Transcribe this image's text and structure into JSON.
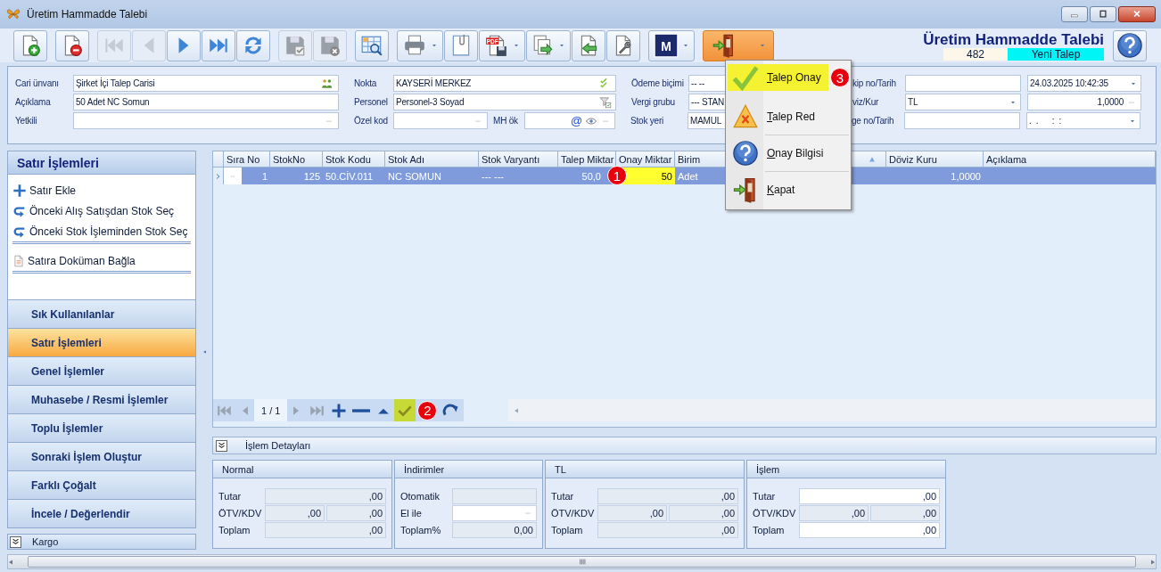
{
  "window": {
    "title": "Üretim Hammadde Talebi"
  },
  "toolbar": [
    [
      {
        "kind": "new",
        "disabled": false
      }
    ],
    [
      {
        "kind": "delete",
        "disabled": false
      }
    ],
    [
      {
        "kind": "first",
        "disabled": true
      },
      {
        "kind": "prev",
        "disabled": true
      },
      {
        "kind": "next",
        "disabled": false
      },
      {
        "kind": "last",
        "disabled": false
      },
      {
        "kind": "refresh",
        "disabled": false
      }
    ],
    [
      {
        "kind": "save",
        "disabled": true
      },
      {
        "kind": "save_close",
        "disabled": true
      }
    ],
    [
      {
        "kind": "grid_search",
        "disabled": false
      }
    ],
    [
      {
        "kind": "print",
        "disabled": false,
        "dropdown": true
      },
      {
        "kind": "attach",
        "disabled": false
      },
      {
        "kind": "pdf",
        "label": "PDF",
        "disabled": false,
        "dropdown": true
      },
      {
        "kind": "export",
        "disabled": false,
        "dropdown": true
      },
      {
        "kind": "import",
        "disabled": false
      },
      {
        "kind": "tools",
        "disabled": false
      }
    ],
    [
      {
        "kind": "logo",
        "label": "M",
        "disabled": false,
        "dropdown": true
      }
    ],
    [
      {
        "kind": "exit",
        "disabled": false,
        "dropdown": true,
        "expanded": true
      }
    ]
  ],
  "header": {
    "title": "Üretim Hammadde Talebi",
    "number": "482",
    "status": "Yeni Talep"
  },
  "form": [
    {
      "cells": [
        {
          "label": "Cari ünvanı",
          "value": "Şirket İçi Talep Carisi",
          "kind": "contact"
        },
        {
          "label": "Nokta",
          "value": "KAYSERİ MERKEZ",
          "kind": "approved"
        },
        {
          "label": "Ödeme biçimi",
          "value": "-- --",
          "kind": "text"
        },
        {
          "label": "kip no/Tarih",
          "kind": "text"
        },
        {
          "value": "24.03.2025 10:42:35",
          "kind": "date"
        }
      ]
    },
    {
      "cells": [
        {
          "label": "Açıklama",
          "value": "50 Adet NC Somun",
          "kind": "text"
        },
        {
          "label": "Personel",
          "value": "Personel-3 Soyad",
          "kind": "filter"
        },
        {
          "label": "Vergi grubu",
          "value": "--- STAN",
          "kind": "text"
        },
        {
          "label": "viz/Kur",
          "value": "TL",
          "kind": "select"
        },
        {
          "value": "1,0000",
          "kind": "rate"
        }
      ]
    },
    {
      "cells": [
        {
          "label": "Yetkili",
          "kind": "browse"
        },
        {
          "label": "Özel kod",
          "kind": "browse"
        },
        {
          "label": "MH ök",
          "at": "@",
          "kind": "code"
        },
        {
          "label": "Stok yeri",
          "value": "MAMUL",
          "kind": "text"
        },
        {
          "label": "ge no/Tarih",
          "kind": "text"
        },
        {
          "value": ".  .      :  :",
          "kind": "date"
        }
      ]
    }
  ],
  "left_panel": {
    "title": "Satır İşlemleri",
    "action_groups": [
      [
        {
          "kind": "add",
          "label": "Satır Ekle"
        },
        {
          "kind": "pick",
          "label": "Önceki Alış Satışdan Stok Seç"
        },
        {
          "kind": "pick",
          "label": "Önceki Stok İşleminden Stok Seç"
        }
      ],
      [
        {
          "kind": "attach",
          "label": "Satıra Doküman Bağla"
        }
      ]
    ],
    "sections": [
      {
        "label": "Sık Kullanılanlar",
        "selected": false
      },
      {
        "label": "Satır İşlemleri",
        "selected": true
      },
      {
        "label": "Genel İşlemler",
        "selected": false
      },
      {
        "label": "Muhasebe / Resmi İşlemler",
        "selected": false
      },
      {
        "label": "Toplu İşlemler",
        "selected": false
      },
      {
        "label": "Sonraki İşlem Oluştur",
        "selected": false
      },
      {
        "label": "Farklı Çoğalt",
        "selected": false
      },
      {
        "label": "İncele / Değerlendir",
        "selected": false
      }
    ],
    "footer": {
      "label": "Kargo",
      "expanded": false
    }
  },
  "table": {
    "columns": [
      {
        "label": "Sıra No"
      },
      {
        "label": "StokNo"
      },
      {
        "label": "Stok Kodu"
      },
      {
        "label": "Stok Adı"
      },
      {
        "label": "Stok Varyantı"
      },
      {
        "label": "Talep Miktar"
      },
      {
        "label": "Onay Miktar"
      },
      {
        "label": "Birim"
      },
      {
        "sorted": true
      },
      {
        "label": "Döviz Kuru"
      },
      {
        "label": "Açıklama"
      }
    ],
    "rows": [
      {
        "selected": true,
        "cells": [
          {
            "text": "1",
            "kind": "number"
          },
          {
            "text": "125",
            "kind": "number"
          },
          {
            "text": "50.CİV.011"
          },
          {
            "text": "NC SOMUN"
          },
          {
            "text": "--- ---"
          },
          {
            "text": "50,0",
            "kind": "number",
            "callout": "1"
          },
          {
            "text": "50",
            "kind": "number",
            "highlight": true
          },
          {
            "text": "Adet"
          },
          {},
          {
            "text": "1,0000",
            "kind": "number"
          },
          {}
        ]
      }
    ],
    "navigator": [
      {
        "kind": "first",
        "disabled": true
      },
      {
        "kind": "prev",
        "disabled": true
      },
      {
        "kind": "page",
        "label": "1 / 1"
      },
      {
        "kind": "next",
        "disabled": true
      },
      {
        "kind": "last",
        "disabled": true
      },
      {
        "kind": "add",
        "disabled": false
      },
      {
        "kind": "remove",
        "disabled": false
      },
      {
        "kind": "up",
        "disabled": false
      },
      {
        "kind": "approve",
        "disabled": false,
        "highlight": true,
        "callout": "2"
      },
      {
        "kind": "redo",
        "disabled": false
      }
    ]
  },
  "details": {
    "title": "İşlem Detayları",
    "expanded": false,
    "groups": [
      {
        "title": "Normal",
        "rows": [
          {
            "label": "Tutar",
            "fields": [
              {
                "value": ",00",
                "editable": false
              }
            ]
          },
          {
            "label": "ÖTV/KDV",
            "fields": [
              {
                "value": ",00",
                "editable": false
              },
              {
                "value": ",00",
                "editable": false
              }
            ]
          },
          {
            "label": "Toplam",
            "fields": [
              {
                "value": ",00",
                "editable": false
              }
            ]
          }
        ]
      },
      {
        "title": "İndirimler",
        "rows": [
          {
            "label": "Otomatik",
            "fields": [
              {
                "editable": false
              }
            ]
          },
          {
            "label": "El ile",
            "fields": [
              {
                "editable": true,
                "kind": "picker"
              }
            ]
          },
          {
            "label": "Toplam%",
            "fields": [
              {
                "value": "0,00",
                "editable": false
              }
            ]
          }
        ]
      },
      {
        "title": "TL",
        "rows": [
          {
            "label": "Tutar",
            "fields": [
              {
                "value": ",00",
                "editable": false
              }
            ]
          },
          {
            "label": "ÖTV/KDV",
            "fields": [
              {
                "value": ",00",
                "editable": false
              },
              {
                "value": ",00",
                "editable": false
              }
            ]
          },
          {
            "label": "Toplam",
            "fields": [
              {
                "value": ",00",
                "editable": false
              }
            ]
          }
        ]
      },
      {
        "title": "İşlem",
        "rows": [
          {
            "label": "Tutar",
            "fields": [
              {
                "value": ",00",
                "editable": true
              }
            ]
          },
          {
            "label": "ÖTV/KDV",
            "fields": [
              {
                "value": ",00",
                "editable": false
              },
              {
                "value": ",00",
                "editable": false
              }
            ]
          },
          {
            "label": "Toplam",
            "fields": [
              {
                "value": ",00",
                "editable": true
              }
            ]
          }
        ]
      }
    ]
  },
  "menu": {
    "groups": [
      [
        {
          "kind": "approve",
          "label": "Talep Onay",
          "selected": true,
          "callout": "3"
        },
        {
          "kind": "reject",
          "label": "Talep Red",
          "selected": false
        }
      ],
      [
        {
          "kind": "info",
          "label": "Onay Bilgisi",
          "selected": false
        }
      ],
      [
        {
          "kind": "close",
          "label": "Kapat",
          "selected": false
        }
      ]
    ]
  }
}
